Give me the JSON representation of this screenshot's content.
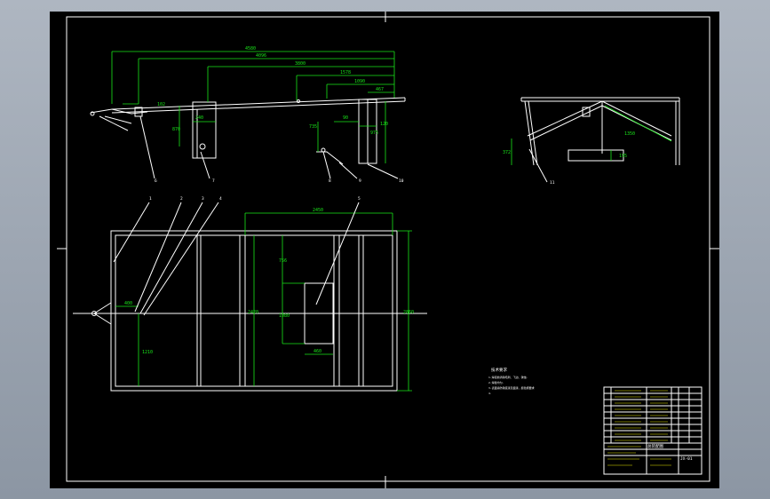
{
  "drawing": {
    "side_view": {
      "dims": [
        "4580",
        "4096",
        "3800",
        "1578",
        "1090",
        "467",
        "102",
        "240",
        "870",
        "90",
        "735",
        "120",
        "975"
      ],
      "callouts": [
        "6",
        "7",
        "8",
        "9",
        "10"
      ]
    },
    "top_view": {
      "dims": [
        "2450",
        "756",
        "1080",
        "460",
        "2420",
        "2860",
        "400",
        "1210"
      ],
      "callouts": [
        "1",
        "2",
        "3",
        "4",
        "5"
      ]
    },
    "end_view": {
      "dims": [
        "372",
        "1350",
        "195"
      ],
      "callouts": [
        "11"
      ]
    },
    "notes": {
      "title": "技术要求",
      "lines": [
        "1.焊接前清除毛刺、飞边、锈蚀.",
        "2.焊缝均匀.",
        "3.表面涂防锈底漆及面漆，颜色按要求",
        "4."
      ]
    },
    "title_block": {
      "name_cell": "总装配图",
      "number_cell": "JX-01"
    }
  }
}
